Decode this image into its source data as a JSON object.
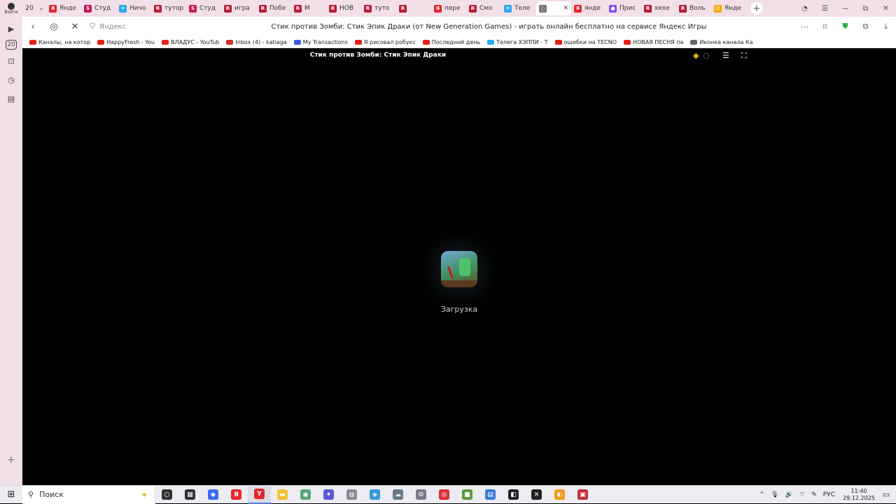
{
  "profile": {
    "label": "Войти"
  },
  "tabbar": {
    "count": "20",
    "tabs": [
      {
        "label": "Янде",
        "color": "#e3262e",
        "glyph": "Я"
      },
      {
        "label": "Студ",
        "color": "#c2185b",
        "glyph": "S"
      },
      {
        "label": "Ничо",
        "color": "#2aabee",
        "glyph": "✈"
      },
      {
        "label": "тутор",
        "color": "#b71c3a",
        "glyph": "R"
      },
      {
        "label": "Студ",
        "color": "#c2185b",
        "glyph": "S"
      },
      {
        "label": "игра",
        "color": "#b71c3a",
        "glyph": "R"
      },
      {
        "label": "Побе",
        "color": "#b71c3a",
        "glyph": "R"
      },
      {
        "label": "М",
        "color": "#b71c3a",
        "glyph": "R"
      },
      {
        "label": "НОВ",
        "color": "#b71c3a",
        "glyph": "R"
      },
      {
        "label": "туто",
        "color": "#b71c3a",
        "glyph": "R"
      },
      {
        "label": "",
        "color": "#b71c3a",
        "glyph": "R"
      },
      {
        "label": "пере",
        "color": "#e3262e",
        "glyph": "Я"
      },
      {
        "label": "Смо",
        "color": "#b71c3a",
        "glyph": "R"
      },
      {
        "label": "Теле",
        "color": "#2aabee",
        "glyph": "✈"
      },
      {
        "label": "",
        "color": "#777777",
        "glyph": "◌",
        "active": true
      },
      {
        "label": "янде",
        "color": "#e3262e",
        "glyph": "Я"
      },
      {
        "label": "Прис",
        "color": "#7c4dff",
        "glyph": "●"
      },
      {
        "label": "хехе",
        "color": "#b71c3a",
        "glyph": "R"
      },
      {
        "label": "Воль",
        "color": "#b71c3a",
        "glyph": "R"
      },
      {
        "label": "Янде",
        "color": "#f2a900",
        "glyph": "☺"
      }
    ]
  },
  "addressbar": {
    "host": "Яндекс",
    "title": "Стик против Зомби: Стик Эпик Драки (от New Generation Games) - играть онлайн бесплатно на сервисе Яндекс Игры"
  },
  "bookmarks": [
    {
      "label": "Каналы, на котор",
      "color": "#e62117"
    },
    {
      "label": "HappyFresh - You",
      "color": "#e62117"
    },
    {
      "label": "ВЛАДУС - YouTub",
      "color": "#e62117"
    },
    {
      "label": "Inbox (4) - katiaga",
      "color": "#d93025",
      "glyph": "M"
    },
    {
      "label": "My Transactions",
      "color": "#3b5bdb"
    },
    {
      "label": "Я рисовал робукс",
      "color": "#e62117"
    },
    {
      "label": "Последний день",
      "color": "#e62117"
    },
    {
      "label": "Телега ХЭППИ - Т",
      "color": "#2aabee"
    },
    {
      "label": "ошибки на ТЕСNО",
      "color": "#e62117"
    },
    {
      "label": "НОВАЯ ПЕСНЯ па",
      "color": "#e62117"
    },
    {
      "label": "Иконка канала Ка",
      "color": "#666666"
    }
  ],
  "sidepanel": {
    "badge": "20"
  },
  "game": {
    "title": "Стик против Зомби: Стик Эпик Драки",
    "loading_text": "Загрузка"
  },
  "taskbar": {
    "search_placeholder": "Поиск",
    "apps": [
      {
        "name": "cortana",
        "color": "#333333",
        "glyph": "○"
      },
      {
        "name": "task-view",
        "color": "#333333",
        "glyph": "▦"
      },
      {
        "name": "app-blue",
        "color": "#3a6df0",
        "glyph": "◆"
      },
      {
        "name": "yandex",
        "color": "#e3262e",
        "glyph": "Я"
      },
      {
        "name": "yandex-browser",
        "color": "#e3262e",
        "glyph": "Y",
        "active": true
      },
      {
        "name": "explorer",
        "color": "#f2c230",
        "glyph": "▬"
      },
      {
        "name": "app-green",
        "color": "#5aa57a",
        "glyph": "◉"
      },
      {
        "name": "app-purple",
        "color": "#5a5ad8",
        "glyph": "✦"
      },
      {
        "name": "app-gray",
        "color": "#8a8a9a",
        "glyph": "◍"
      },
      {
        "name": "app-drop",
        "color": "#3a9ad8",
        "glyph": "◈"
      },
      {
        "name": "app-cloud",
        "color": "#6a7a8a",
        "glyph": "☁"
      },
      {
        "name": "app-tools",
        "color": "#7a7a8a",
        "glyph": "⚙"
      },
      {
        "name": "app-red",
        "color": "#d8323a",
        "glyph": "◎"
      },
      {
        "name": "minecraft",
        "color": "#5a9a3a",
        "glyph": "■"
      },
      {
        "name": "calculator",
        "color": "#3a7ad8",
        "glyph": "▤"
      },
      {
        "name": "roblox",
        "color": "#222222",
        "glyph": "◧"
      },
      {
        "name": "app-x",
        "color": "#222222",
        "glyph": "✕"
      },
      {
        "name": "app-orange",
        "color": "#f29a1a",
        "glyph": "◐"
      },
      {
        "name": "app-game",
        "color": "#c2323a",
        "glyph": "▣"
      }
    ],
    "language": "РУС",
    "time": "11:40",
    "date": "29.12.2025"
  }
}
